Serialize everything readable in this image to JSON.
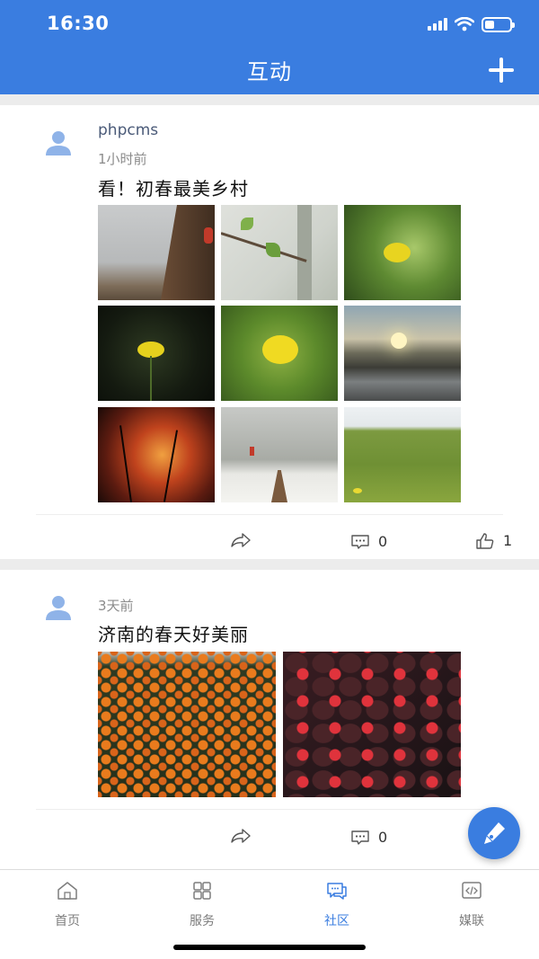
{
  "status_bar": {
    "time": "16:30"
  },
  "header": {
    "title": "互动"
  },
  "posts": [
    {
      "username": "phpcms",
      "time": "1小时前",
      "title": "看！初春最美乡村",
      "actions": {
        "comments": "0",
        "likes": "1"
      }
    },
    {
      "username": "",
      "time": "3天前",
      "title": "济南的春天好美丽",
      "actions": {
        "comments": "0"
      }
    }
  ],
  "tabs": [
    {
      "label": "首页",
      "icon": "home-icon"
    },
    {
      "label": "服务",
      "icon": "grid-icon"
    },
    {
      "label": "社区",
      "icon": "chat-icon"
    },
    {
      "label": "媒联",
      "icon": "code-icon"
    }
  ],
  "colors": {
    "accent": "#3a7de0",
    "background": "#ececec",
    "tab_inactive": "#7d7d7d"
  }
}
